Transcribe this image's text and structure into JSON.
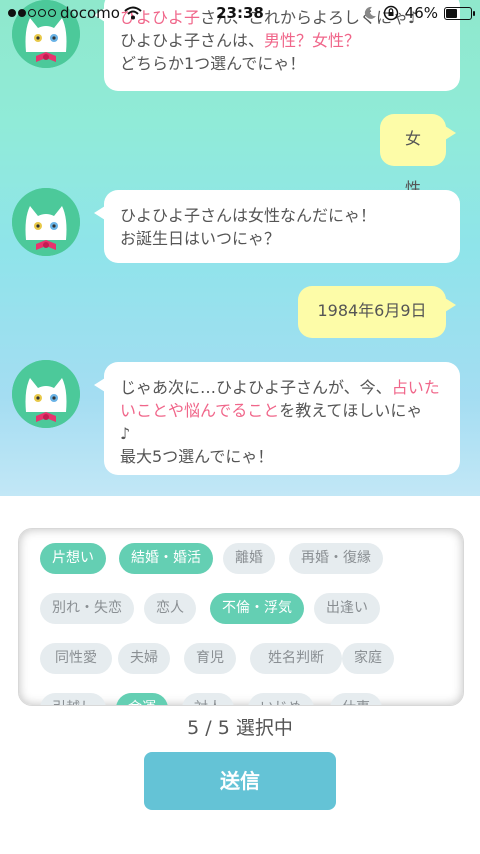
{
  "status_bar": {
    "carrier": "docomo",
    "time": "23:38",
    "battery": "46%",
    "battery_level": 0.46
  },
  "messages": [
    {
      "from": "bot",
      "lines": [
        {
          "parts": [
            {
              "text": "ひよひよ子",
              "pink": true
            },
            {
              "text": "さん、これからよろしくにゃ♪"
            }
          ]
        },
        {
          "parts": [
            {
              "text": "ひよひよ子さんは、"
            },
            {
              "text": "男性？女性？",
              "pink": true
            }
          ]
        },
        {
          "parts": [
            {
              "text": "どちらか1つ選んでにゃ！"
            }
          ]
        }
      ]
    },
    {
      "from": "user",
      "text": "女性"
    },
    {
      "from": "bot",
      "lines": [
        {
          "parts": [
            {
              "text": "ひよひよ子さんは女性なんだにゃ！"
            }
          ]
        },
        {
          "parts": [
            {
              "text": "お誕生日はいつにゃ？"
            }
          ]
        }
      ]
    },
    {
      "from": "user",
      "text": "1984年6月9日"
    },
    {
      "from": "bot",
      "lines": [
        {
          "parts": [
            {
              "text": "じゃあ次に…ひよひよ子さんが、今、"
            },
            {
              "text": "占いた",
              "pink": true
            }
          ]
        },
        {
          "parts": [
            {
              "text": "いことや悩んでること",
              "pink": true
            },
            {
              "text": "を教えてほしいにゃ"
            }
          ]
        },
        {
          "parts": [
            {
              "text": "♪"
            }
          ]
        },
        {
          "parts": [
            {
              "text": "最大5つ選んでにゃ！"
            }
          ]
        }
      ]
    }
  ],
  "topics": [
    {
      "label": "片想い",
      "selected": true
    },
    {
      "label": "結婚・婚活",
      "selected": true
    },
    {
      "label": "離婚",
      "selected": false
    },
    {
      "label": "再婚・復縁",
      "selected": false
    },
    {
      "label": "別れ・失恋",
      "selected": false
    },
    {
      "label": "恋人",
      "selected": false
    },
    {
      "label": "不倫・浮気",
      "selected": true
    },
    {
      "label": "出逢い",
      "selected": false
    },
    {
      "label": "同性愛",
      "selected": false
    },
    {
      "label": "夫婦",
      "selected": false
    },
    {
      "label": "育児",
      "selected": false
    },
    {
      "label": "姓名判断",
      "selected": false
    },
    {
      "label": "家庭",
      "selected": false
    },
    {
      "label": "引越し",
      "selected": false
    },
    {
      "label": "金運",
      "selected": true
    },
    {
      "label": "対人",
      "selected": false
    },
    {
      "label": "いじめ",
      "selected": false
    },
    {
      "label": "仕事",
      "selected": false
    }
  ],
  "selection_counter": "5 / 5 選択中",
  "send_button": "送信",
  "colors": {
    "accent_teal": "#64cfb3",
    "send_button": "#64c3d6",
    "pink_highlight": "#f0668a",
    "user_bubble": "#fdfca8"
  }
}
